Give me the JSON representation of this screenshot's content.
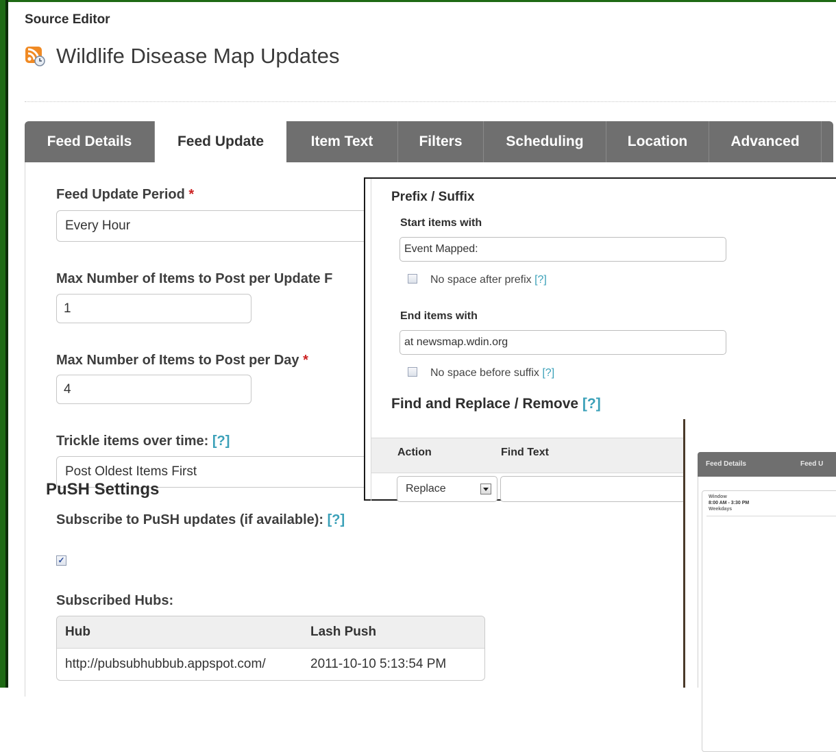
{
  "header": {
    "app_label": "Source Editor",
    "page_title": "Wildlife Disease Map Updates"
  },
  "tabs": [
    "Feed Details",
    "Feed Update",
    "Item Text",
    "Filters",
    "Scheduling",
    "Location",
    "Advanced"
  ],
  "active_tab": "Feed Update",
  "form": {
    "update_period_label": "Feed Update Period",
    "update_period_value": "Every Hour",
    "max_per_update_label": "Max Number of Items to Post per Update F",
    "max_per_update_value": "1",
    "max_per_day_label": "Max Number of Items to Post per Day",
    "max_per_day_value": "4",
    "trickle_label": "Trickle items over time:",
    "trickle_value": "Post Oldest Items First",
    "required_mark": "*",
    "help": "[?]"
  },
  "push": {
    "section_title": "PuSH Settings",
    "subscribe_label": "Subscribe to PuSH updates (if available):",
    "subscribe_checked": true,
    "hubs_label": "Subscribed Hubs:",
    "hubs_headers": [
      "Hub",
      "Lash Push"
    ],
    "hubs_rows": [
      [
        "http://pubsubhubbub.appspot.com/",
        "2011-10-10 5:13:54 PM"
      ]
    ]
  },
  "overlay_item_text": {
    "title": "Prefix / Suffix",
    "start_label": "Start items with",
    "start_value": "Event Mapped:",
    "no_space_prefix": "No space after prefix",
    "end_label": "End items with",
    "end_value": "at newsmap.wdin.org",
    "no_space_suffix": "No space before suffix",
    "find_title": "Find and Replace / Remove",
    "help": "[?]",
    "col_action": "Action",
    "col_find": "Find Text",
    "action_value": "Replace"
  },
  "overlay_scheduling": {
    "tab1": "Feed Details",
    "tab2": "Feed U",
    "window_label": "Window",
    "window_time": "8:00 AM - 3:30 PM",
    "window_days": "Weekdays"
  },
  "colors": {
    "frame": "#1e6a14",
    "tab_bar": "#6f6f6f",
    "help_link": "#3aa0b8",
    "required": "#cc2222"
  }
}
